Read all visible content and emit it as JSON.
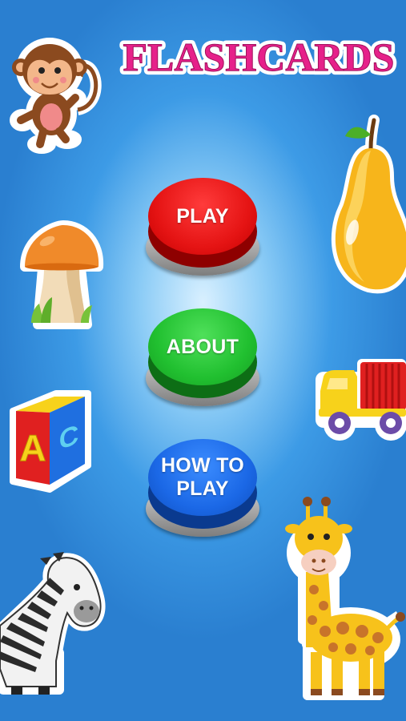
{
  "app": {
    "title": "FLASHCARDS"
  },
  "menu": {
    "play_label": "PLAY",
    "about_label": "ABOUT",
    "how_to_play_line1": "HOW TO",
    "how_to_play_line2": "PLAY"
  },
  "stickers": [
    {
      "name": "monkey-icon"
    },
    {
      "name": "pear-icon"
    },
    {
      "name": "mushroom-icon"
    },
    {
      "name": "toy-truck-icon"
    },
    {
      "name": "abc-block-icon"
    },
    {
      "name": "zebra-icon"
    },
    {
      "name": "giraffe-icon"
    }
  ],
  "colors": {
    "background": "#3d9be6",
    "title_fill": "#e6218a",
    "play_button": "#e51414",
    "about_button": "#21c030",
    "how_to_play_button": "#1b68e6"
  }
}
